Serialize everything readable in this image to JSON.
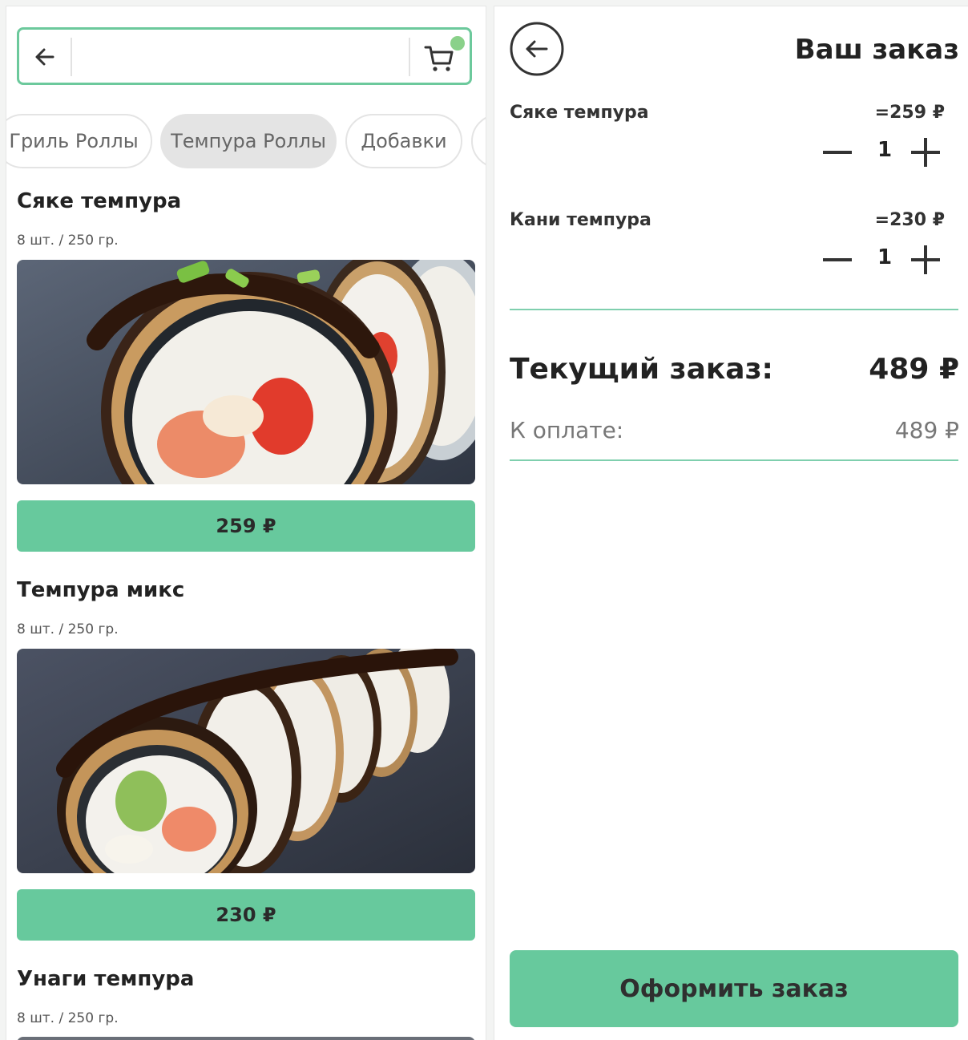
{
  "catalog": {
    "search": {
      "value": "",
      "placeholder": ""
    },
    "cart_badge_color": "#8ad18a",
    "categories": [
      {
        "label": "Гриль Роллы",
        "active": false
      },
      {
        "label": "Темпура Роллы",
        "active": true
      },
      {
        "label": "Добавки",
        "active": false
      }
    ],
    "items": [
      {
        "title": "Сяке темпура",
        "meta": "8 шт. / 250 гр.",
        "price": "259 ₽"
      },
      {
        "title": "Темпура микс",
        "meta": "8 шт. / 250 гр.",
        "price": "230 ₽"
      },
      {
        "title": "Унаги темпура",
        "meta": "8 шт. / 250 гр."
      }
    ]
  },
  "order": {
    "title": "Ваш заказ",
    "lines": [
      {
        "name": "Сяке темпура",
        "price": "=259 ₽",
        "qty": "1"
      },
      {
        "name": "Кани темпура",
        "price": "=230 ₽",
        "qty": "1"
      }
    ],
    "current_label": "Текущий заказ:",
    "current_value": "489 ₽",
    "pay_label": "К оплате:",
    "pay_value": "489 ₽",
    "checkout_label": "Оформить заказ"
  },
  "colors": {
    "accent": "#67c99d",
    "border_accent": "#6cc99c"
  }
}
